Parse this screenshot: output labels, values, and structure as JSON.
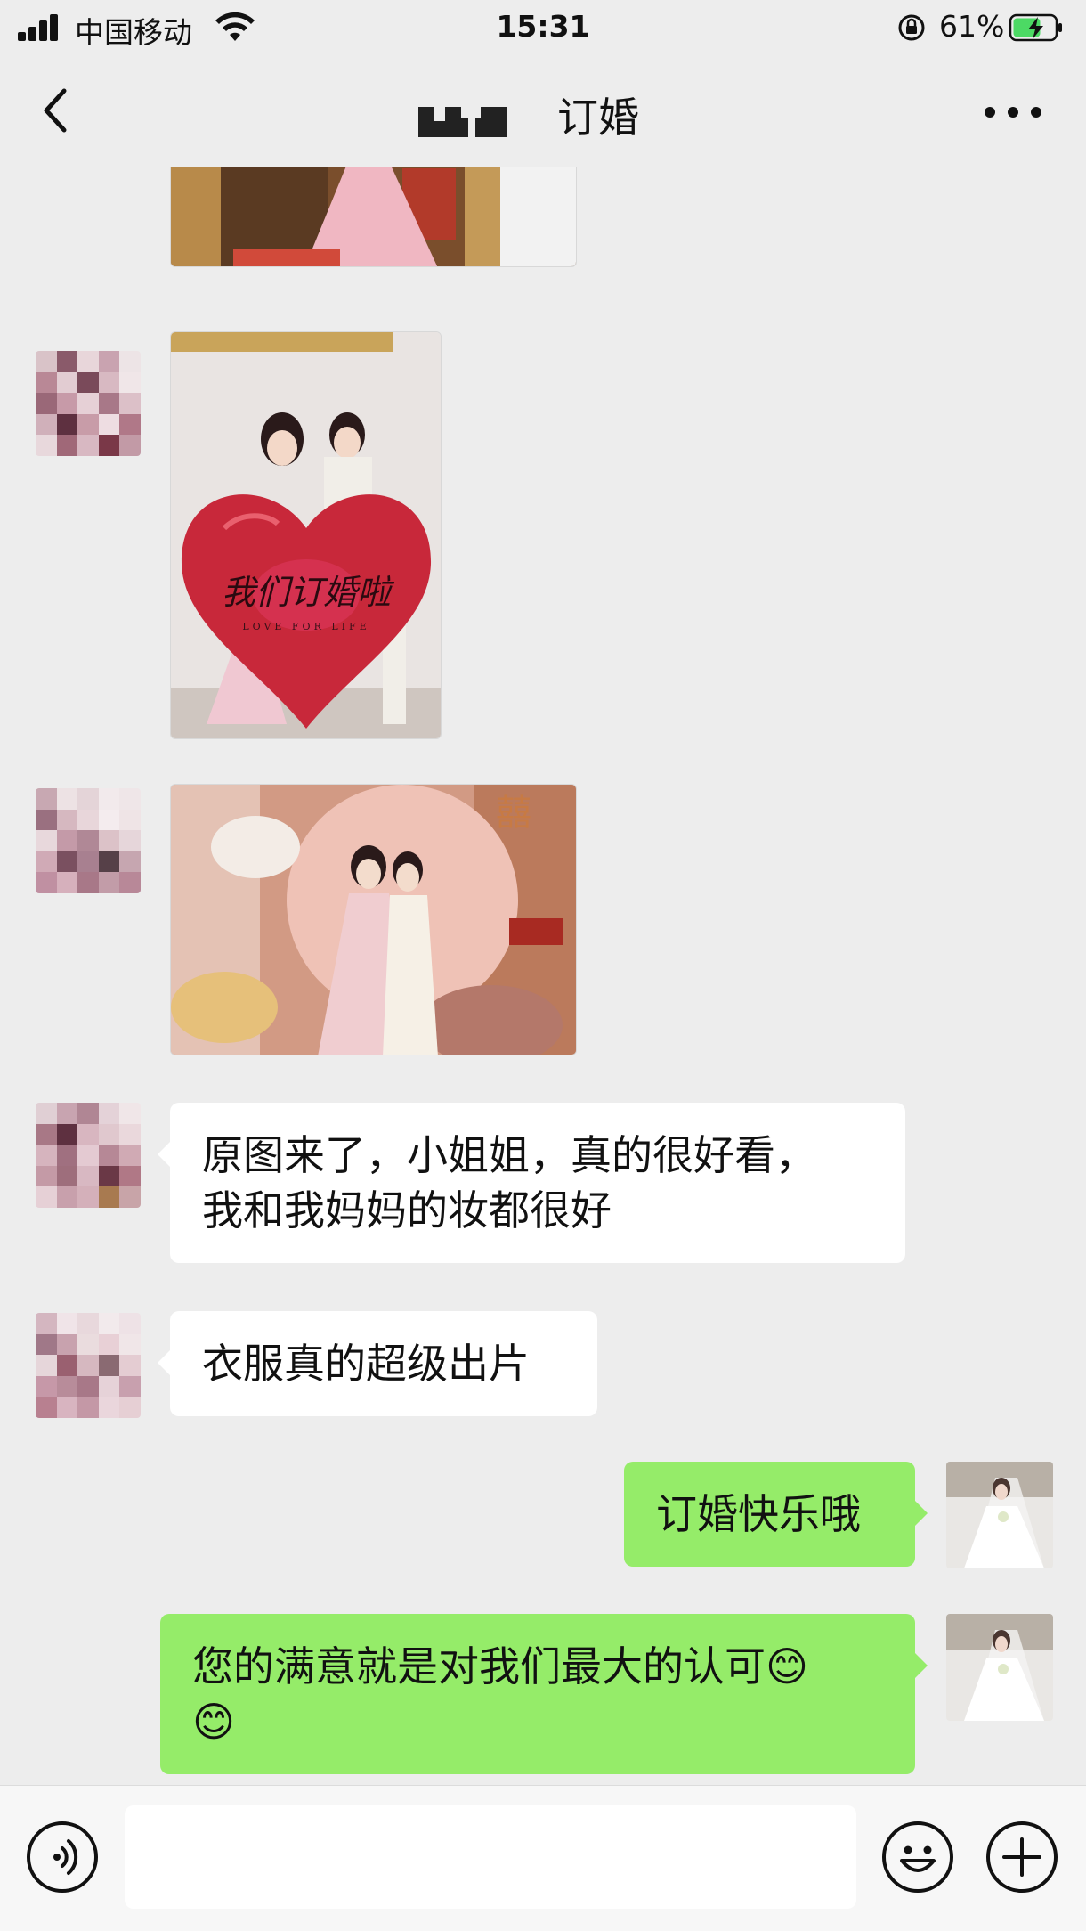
{
  "status_bar": {
    "carrier": "中国移动",
    "time": "15:31",
    "battery_percent": "61%"
  },
  "nav": {
    "title": "订婚",
    "back_icon": "chevron-left-icon",
    "more_icon": "more-dots-icon"
  },
  "messages": [
    {
      "side": "left",
      "type": "image",
      "caption": ""
    },
    {
      "side": "left",
      "type": "image",
      "caption": "",
      "image_text": "我们订婚啦",
      "image_subtext": "LOVE FOR LIFE"
    },
    {
      "side": "left",
      "type": "image",
      "caption": ""
    },
    {
      "side": "left",
      "type": "text",
      "text": "原图来了，小姐姐，真的很好看，\n我和我妈妈的妆都很好"
    },
    {
      "side": "left",
      "type": "text",
      "text": "衣服真的超级出片"
    },
    {
      "side": "right",
      "type": "text",
      "text": "订婚快乐哦"
    },
    {
      "side": "right",
      "type": "text",
      "text": "您的满意就是对我们最大的认可😊\n😊"
    }
  ],
  "input_bar": {
    "voice_icon": "voice-icon",
    "emoji_icon": "emoji-icon",
    "plus_icon": "plus-icon",
    "input_value": ""
  },
  "colors": {
    "background": "#ededed",
    "bubble_right": "#95ec69",
    "bubble_left": "#ffffff",
    "battery_fill": "#4cd964"
  }
}
